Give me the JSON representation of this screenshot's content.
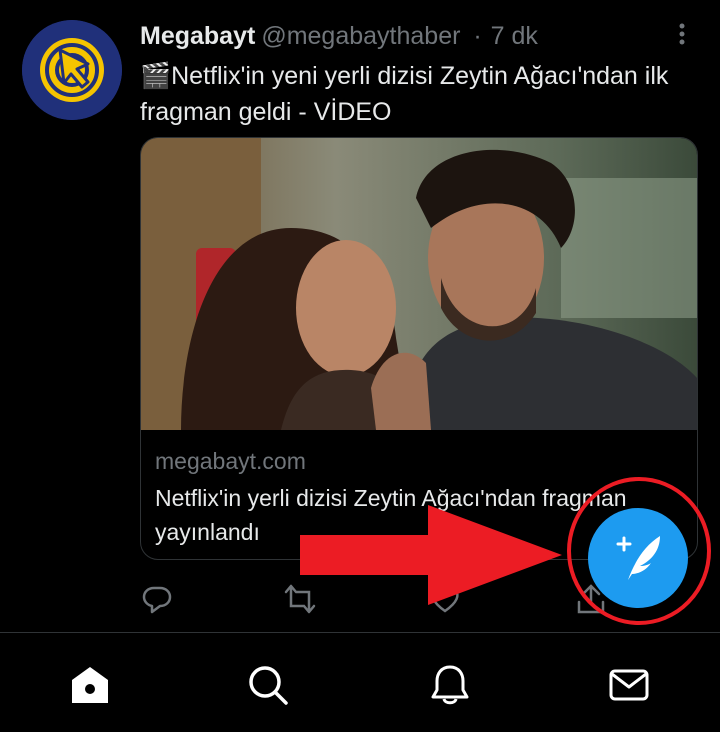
{
  "tweet": {
    "display_name": "Megabayt",
    "handle": "@megabaythaber",
    "separator": "·",
    "time": "7 dk",
    "text": "🎬Netflix'in yeni yerli dizisi Zeytin Ağacı'ndan ilk fragman geldi - VİDEO",
    "card": {
      "domain": "megabayt.com",
      "title": "Netflix'in yerli dizisi Zeytin Ağacı'ndan fragman yayınlandı"
    },
    "actions": [
      "reply-icon",
      "retweet-icon",
      "like-icon",
      "share-icon"
    ]
  },
  "tabbar": {
    "items": [
      "home-icon",
      "search-icon",
      "notifications-icon",
      "messages-icon"
    ]
  },
  "fab": {
    "icon": "compose-tweet-icon",
    "color": "#1d9bf0"
  },
  "annotation": {
    "arrow_color": "#ec1c24",
    "circle_color": "#ec1c24"
  },
  "colors": {
    "background": "#000000",
    "text": "#e7e9ea",
    "muted": "#71767b"
  }
}
